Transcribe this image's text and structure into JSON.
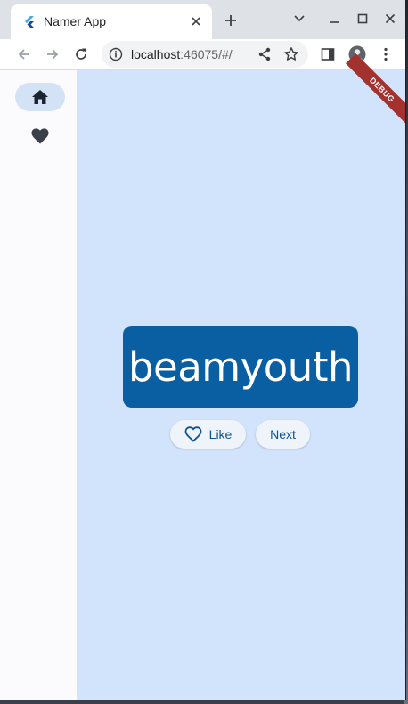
{
  "browser": {
    "tab_title": "Namer App",
    "url_host": "localhost",
    "url_rest": ":46075/#/"
  },
  "nav": {
    "items": [
      {
        "icon": "home-icon",
        "selected": true
      },
      {
        "icon": "heart-icon",
        "selected": false
      }
    ]
  },
  "main": {
    "word": "beamyouth",
    "like_label": "Like",
    "next_label": "Next"
  },
  "debug_banner": "DEBUG",
  "colors": {
    "app_background": "#d2e3fc",
    "card": "#0a5fa3",
    "accent_text": "#0b5394",
    "debug_banner": "#a3312e"
  }
}
